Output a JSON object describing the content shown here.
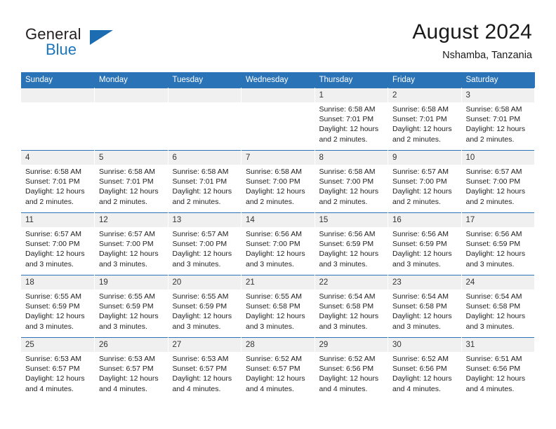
{
  "brand": {
    "name_top": "General",
    "name_bottom": "Blue",
    "logo_icon": "triangle-flag-icon"
  },
  "header": {
    "title": "August 2024",
    "location": "Nshamba, Tanzania"
  },
  "colors": {
    "header_blue": "#2b73b7",
    "brand_blue": "#1b75bb",
    "daynum_bg": "#f0f0f0"
  },
  "weekdays": [
    "Sunday",
    "Monday",
    "Tuesday",
    "Wednesday",
    "Thursday",
    "Friday",
    "Saturday"
  ],
  "weeks": [
    [
      {
        "empty": true
      },
      {
        "empty": true
      },
      {
        "empty": true
      },
      {
        "empty": true
      },
      {
        "day": "1",
        "sunrise": "Sunrise: 6:58 AM",
        "sunset": "Sunset: 7:01 PM",
        "daylight": "Daylight: 12 hours and 2 minutes."
      },
      {
        "day": "2",
        "sunrise": "Sunrise: 6:58 AM",
        "sunset": "Sunset: 7:01 PM",
        "daylight": "Daylight: 12 hours and 2 minutes."
      },
      {
        "day": "3",
        "sunrise": "Sunrise: 6:58 AM",
        "sunset": "Sunset: 7:01 PM",
        "daylight": "Daylight: 12 hours and 2 minutes."
      }
    ],
    [
      {
        "day": "4",
        "sunrise": "Sunrise: 6:58 AM",
        "sunset": "Sunset: 7:01 PM",
        "daylight": "Daylight: 12 hours and 2 minutes."
      },
      {
        "day": "5",
        "sunrise": "Sunrise: 6:58 AM",
        "sunset": "Sunset: 7:01 PM",
        "daylight": "Daylight: 12 hours and 2 minutes."
      },
      {
        "day": "6",
        "sunrise": "Sunrise: 6:58 AM",
        "sunset": "Sunset: 7:01 PM",
        "daylight": "Daylight: 12 hours and 2 minutes."
      },
      {
        "day": "7",
        "sunrise": "Sunrise: 6:58 AM",
        "sunset": "Sunset: 7:00 PM",
        "daylight": "Daylight: 12 hours and 2 minutes."
      },
      {
        "day": "8",
        "sunrise": "Sunrise: 6:58 AM",
        "sunset": "Sunset: 7:00 PM",
        "daylight": "Daylight: 12 hours and 2 minutes."
      },
      {
        "day": "9",
        "sunrise": "Sunrise: 6:57 AM",
        "sunset": "Sunset: 7:00 PM",
        "daylight": "Daylight: 12 hours and 2 minutes."
      },
      {
        "day": "10",
        "sunrise": "Sunrise: 6:57 AM",
        "sunset": "Sunset: 7:00 PM",
        "daylight": "Daylight: 12 hours and 2 minutes."
      }
    ],
    [
      {
        "day": "11",
        "sunrise": "Sunrise: 6:57 AM",
        "sunset": "Sunset: 7:00 PM",
        "daylight": "Daylight: 12 hours and 3 minutes."
      },
      {
        "day": "12",
        "sunrise": "Sunrise: 6:57 AM",
        "sunset": "Sunset: 7:00 PM",
        "daylight": "Daylight: 12 hours and 3 minutes."
      },
      {
        "day": "13",
        "sunrise": "Sunrise: 6:57 AM",
        "sunset": "Sunset: 7:00 PM",
        "daylight": "Daylight: 12 hours and 3 minutes."
      },
      {
        "day": "14",
        "sunrise": "Sunrise: 6:56 AM",
        "sunset": "Sunset: 7:00 PM",
        "daylight": "Daylight: 12 hours and 3 minutes."
      },
      {
        "day": "15",
        "sunrise": "Sunrise: 6:56 AM",
        "sunset": "Sunset: 6:59 PM",
        "daylight": "Daylight: 12 hours and 3 minutes."
      },
      {
        "day": "16",
        "sunrise": "Sunrise: 6:56 AM",
        "sunset": "Sunset: 6:59 PM",
        "daylight": "Daylight: 12 hours and 3 minutes."
      },
      {
        "day": "17",
        "sunrise": "Sunrise: 6:56 AM",
        "sunset": "Sunset: 6:59 PM",
        "daylight": "Daylight: 12 hours and 3 minutes."
      }
    ],
    [
      {
        "day": "18",
        "sunrise": "Sunrise: 6:55 AM",
        "sunset": "Sunset: 6:59 PM",
        "daylight": "Daylight: 12 hours and 3 minutes."
      },
      {
        "day": "19",
        "sunrise": "Sunrise: 6:55 AM",
        "sunset": "Sunset: 6:59 PM",
        "daylight": "Daylight: 12 hours and 3 minutes."
      },
      {
        "day": "20",
        "sunrise": "Sunrise: 6:55 AM",
        "sunset": "Sunset: 6:59 PM",
        "daylight": "Daylight: 12 hours and 3 minutes."
      },
      {
        "day": "21",
        "sunrise": "Sunrise: 6:55 AM",
        "sunset": "Sunset: 6:58 PM",
        "daylight": "Daylight: 12 hours and 3 minutes."
      },
      {
        "day": "22",
        "sunrise": "Sunrise: 6:54 AM",
        "sunset": "Sunset: 6:58 PM",
        "daylight": "Daylight: 12 hours and 3 minutes."
      },
      {
        "day": "23",
        "sunrise": "Sunrise: 6:54 AM",
        "sunset": "Sunset: 6:58 PM",
        "daylight": "Daylight: 12 hours and 3 minutes."
      },
      {
        "day": "24",
        "sunrise": "Sunrise: 6:54 AM",
        "sunset": "Sunset: 6:58 PM",
        "daylight": "Daylight: 12 hours and 3 minutes."
      }
    ],
    [
      {
        "day": "25",
        "sunrise": "Sunrise: 6:53 AM",
        "sunset": "Sunset: 6:57 PM",
        "daylight": "Daylight: 12 hours and 4 minutes."
      },
      {
        "day": "26",
        "sunrise": "Sunrise: 6:53 AM",
        "sunset": "Sunset: 6:57 PM",
        "daylight": "Daylight: 12 hours and 4 minutes."
      },
      {
        "day": "27",
        "sunrise": "Sunrise: 6:53 AM",
        "sunset": "Sunset: 6:57 PM",
        "daylight": "Daylight: 12 hours and 4 minutes."
      },
      {
        "day": "28",
        "sunrise": "Sunrise: 6:52 AM",
        "sunset": "Sunset: 6:57 PM",
        "daylight": "Daylight: 12 hours and 4 minutes."
      },
      {
        "day": "29",
        "sunrise": "Sunrise: 6:52 AM",
        "sunset": "Sunset: 6:56 PM",
        "daylight": "Daylight: 12 hours and 4 minutes."
      },
      {
        "day": "30",
        "sunrise": "Sunrise: 6:52 AM",
        "sunset": "Sunset: 6:56 PM",
        "daylight": "Daylight: 12 hours and 4 minutes."
      },
      {
        "day": "31",
        "sunrise": "Sunrise: 6:51 AM",
        "sunset": "Sunset: 6:56 PM",
        "daylight": "Daylight: 12 hours and 4 minutes."
      }
    ]
  ]
}
